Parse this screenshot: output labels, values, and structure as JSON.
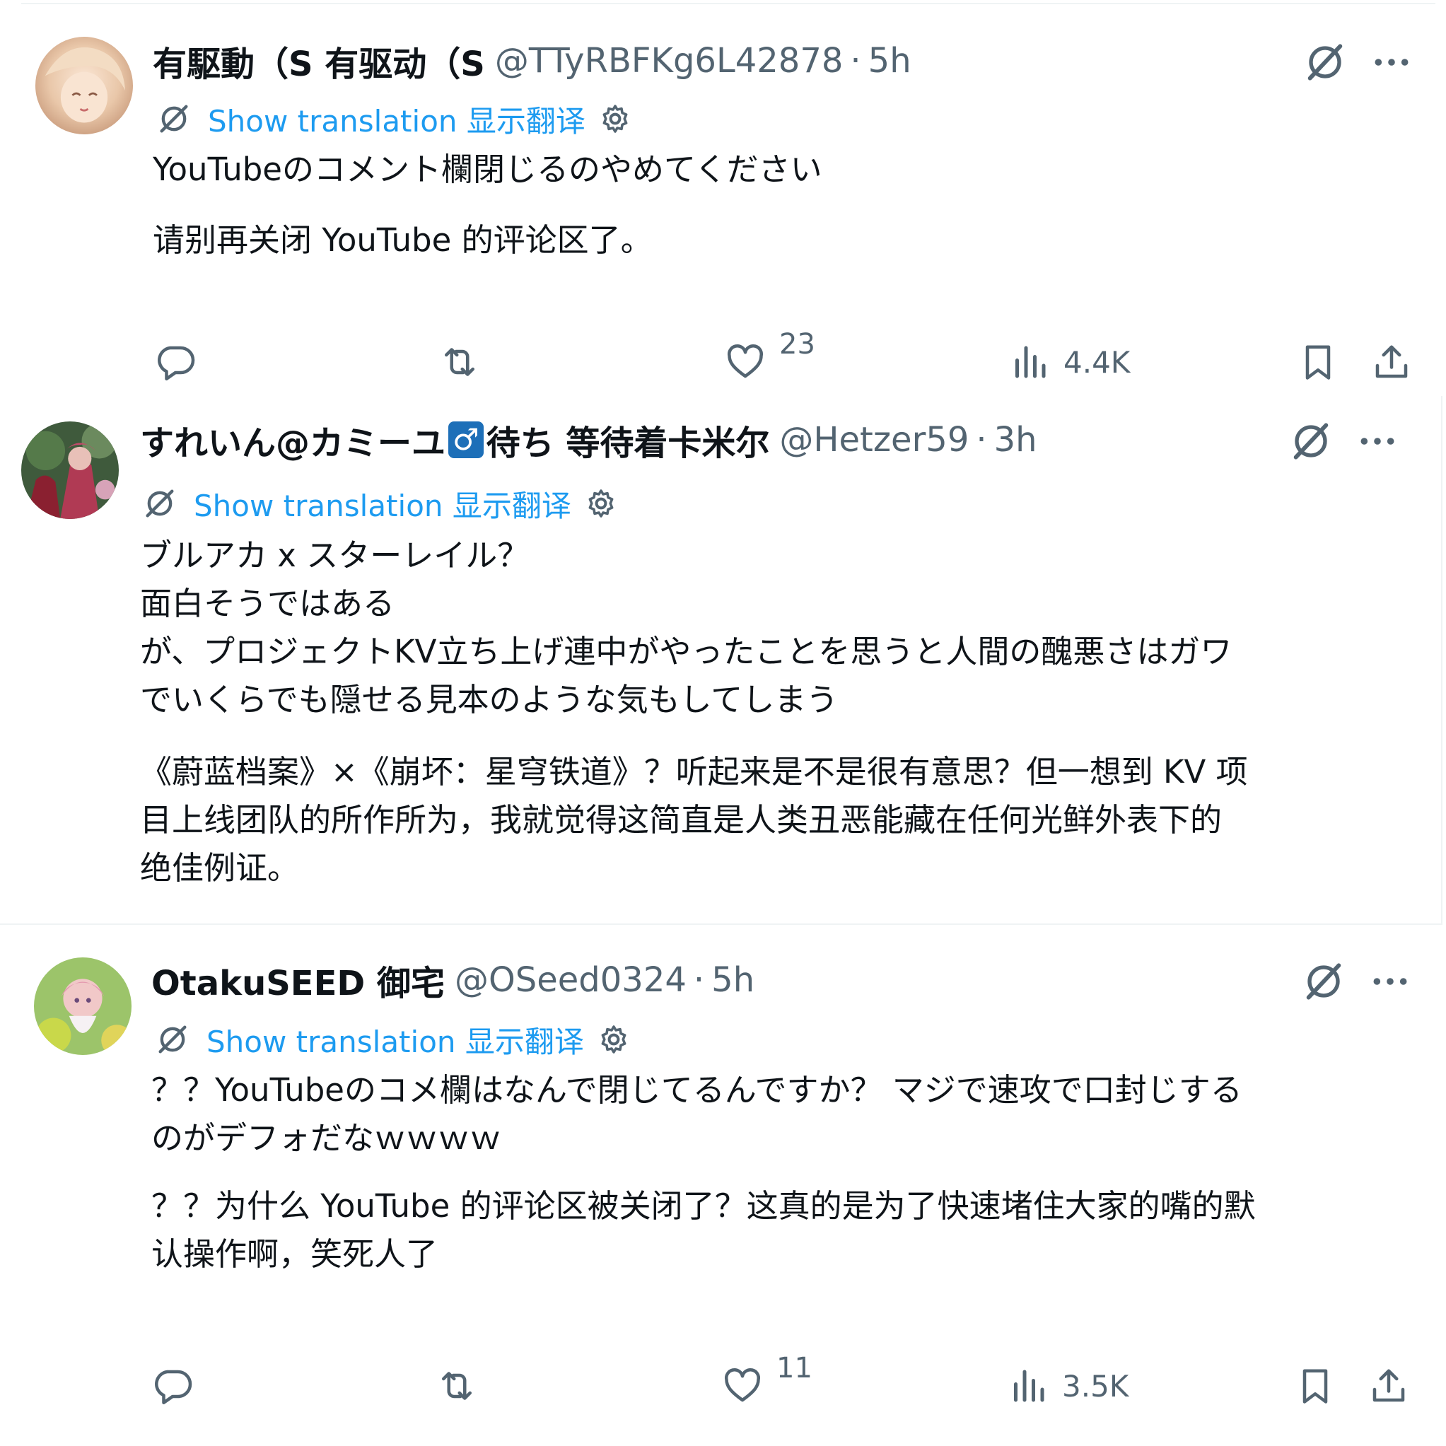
{
  "tweets": [
    {
      "name": "有駆動（S 有驱动（S",
      "handle": "@TTyRBFKg6L42878",
      "time": "5h",
      "translate_label": "Show translation 显示翻译",
      "original_text": "YouTubeのコメント欄閉じるのやめてください",
      "translated_text": "请别再关闭 YouTube 的评论区了。",
      "likes": "23",
      "views": "4.4K"
    },
    {
      "name_part1": "すれいん@カミーユ",
      "badge": "♂",
      "name_part2": "待ち 等待着卡米尔",
      "handle": "@Hetzer59",
      "time": "3h",
      "translate_label": "Show translation 显示翻译",
      "original_text": "ブルアカ x スターレイル？\n面白そうではある\nが、プロジェクトKV立ち上げ連中がやったことを思うと人間の醜悪さはガワ\nでいくらでも隠せる見本のような気もしてしまう",
      "translated_text": "《蔚蓝档案》×《崩坏：星穹铁道》？听起来是不是很有意思？但一想到 KV 项\n目上线团队的所作所为，我就觉得这简直是人类丑恶能藏在任何光鲜外表下的\n绝佳例证。"
    },
    {
      "name": "OtakuSEED 御宅",
      "handle": "@OSeed0324",
      "time": "5h",
      "translate_label": "Show translation 显示翻译",
      "original_text": "？？YouTubeのコメ欄はなんで閉じてるんですか？ マジで速攻で口封じする\nのがデフォだなｗｗｗｗ",
      "translated_text": "？？为什么 YouTube 的评论区被关闭了？这真的是为了快速堵住大家的嘴的默\n认操作啊，笑死人了",
      "likes": "11",
      "views": "3.5K"
    }
  ],
  "separator": "·",
  "colors": {
    "accent": "#1d9bf0",
    "secondary": "#536471",
    "text": "#0f1419",
    "divider": "#eff3f4"
  },
  "icons": [
    "reply-icon",
    "retweet-icon",
    "like-icon",
    "views-icon",
    "bookmark-icon",
    "share-icon",
    "grok-icon",
    "more-icon",
    "translate-icon",
    "gear-icon"
  ]
}
